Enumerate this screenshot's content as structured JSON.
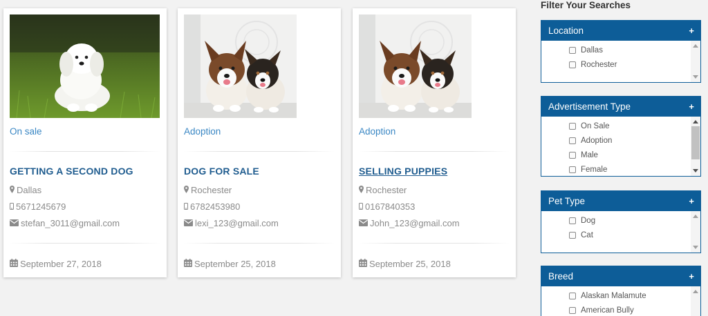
{
  "listings": [
    {
      "category": "On sale",
      "title": "GETTING A SECOND DOG",
      "location": "Dallas",
      "phone": "5671245679",
      "email": "stefan_3011@gmail.com",
      "date": "September 27, 2018",
      "photo": "maltese-puppy-on-grass"
    },
    {
      "category": "Adoption",
      "title": "DOG FOR SALE",
      "location": "Rochester",
      "phone": "6782453980",
      "email": "lexi_123@gmail.com",
      "date": "September 25, 2018",
      "photo": "two-corgi-puppies"
    },
    {
      "category": "Adoption",
      "title": "SELLING PUPPIES",
      "location": "Rochester",
      "phone": "0167840353",
      "email": "John_123@gmail.com",
      "date": "September 25, 2018",
      "photo": "two-corgi-puppies"
    }
  ],
  "icons": {
    "location": "map-marker-icon",
    "phone": "mobile-phone-icon",
    "email": "envelope-icon",
    "date": "calendar-icon"
  },
  "sidebar": {
    "title": "Filter Your Searches",
    "expand_symbol": "+",
    "filters": [
      {
        "label": "Location",
        "options": [
          "Dallas",
          "Rochester"
        ]
      },
      {
        "label": "Advertisement Type",
        "options": [
          "On Sale",
          "Adoption",
          "Male",
          "Female"
        ]
      },
      {
        "label": "Pet Type",
        "options": [
          "Dog",
          "Cat"
        ]
      },
      {
        "label": "Breed",
        "options": [
          "Alaskan Malamute",
          "American Bully"
        ]
      }
    ]
  },
  "colors": {
    "header_blue": "#0d5d98",
    "title_blue": "#1f5c8f",
    "link_blue": "#3a87c4",
    "meta_gray": "#8a8a8a"
  }
}
